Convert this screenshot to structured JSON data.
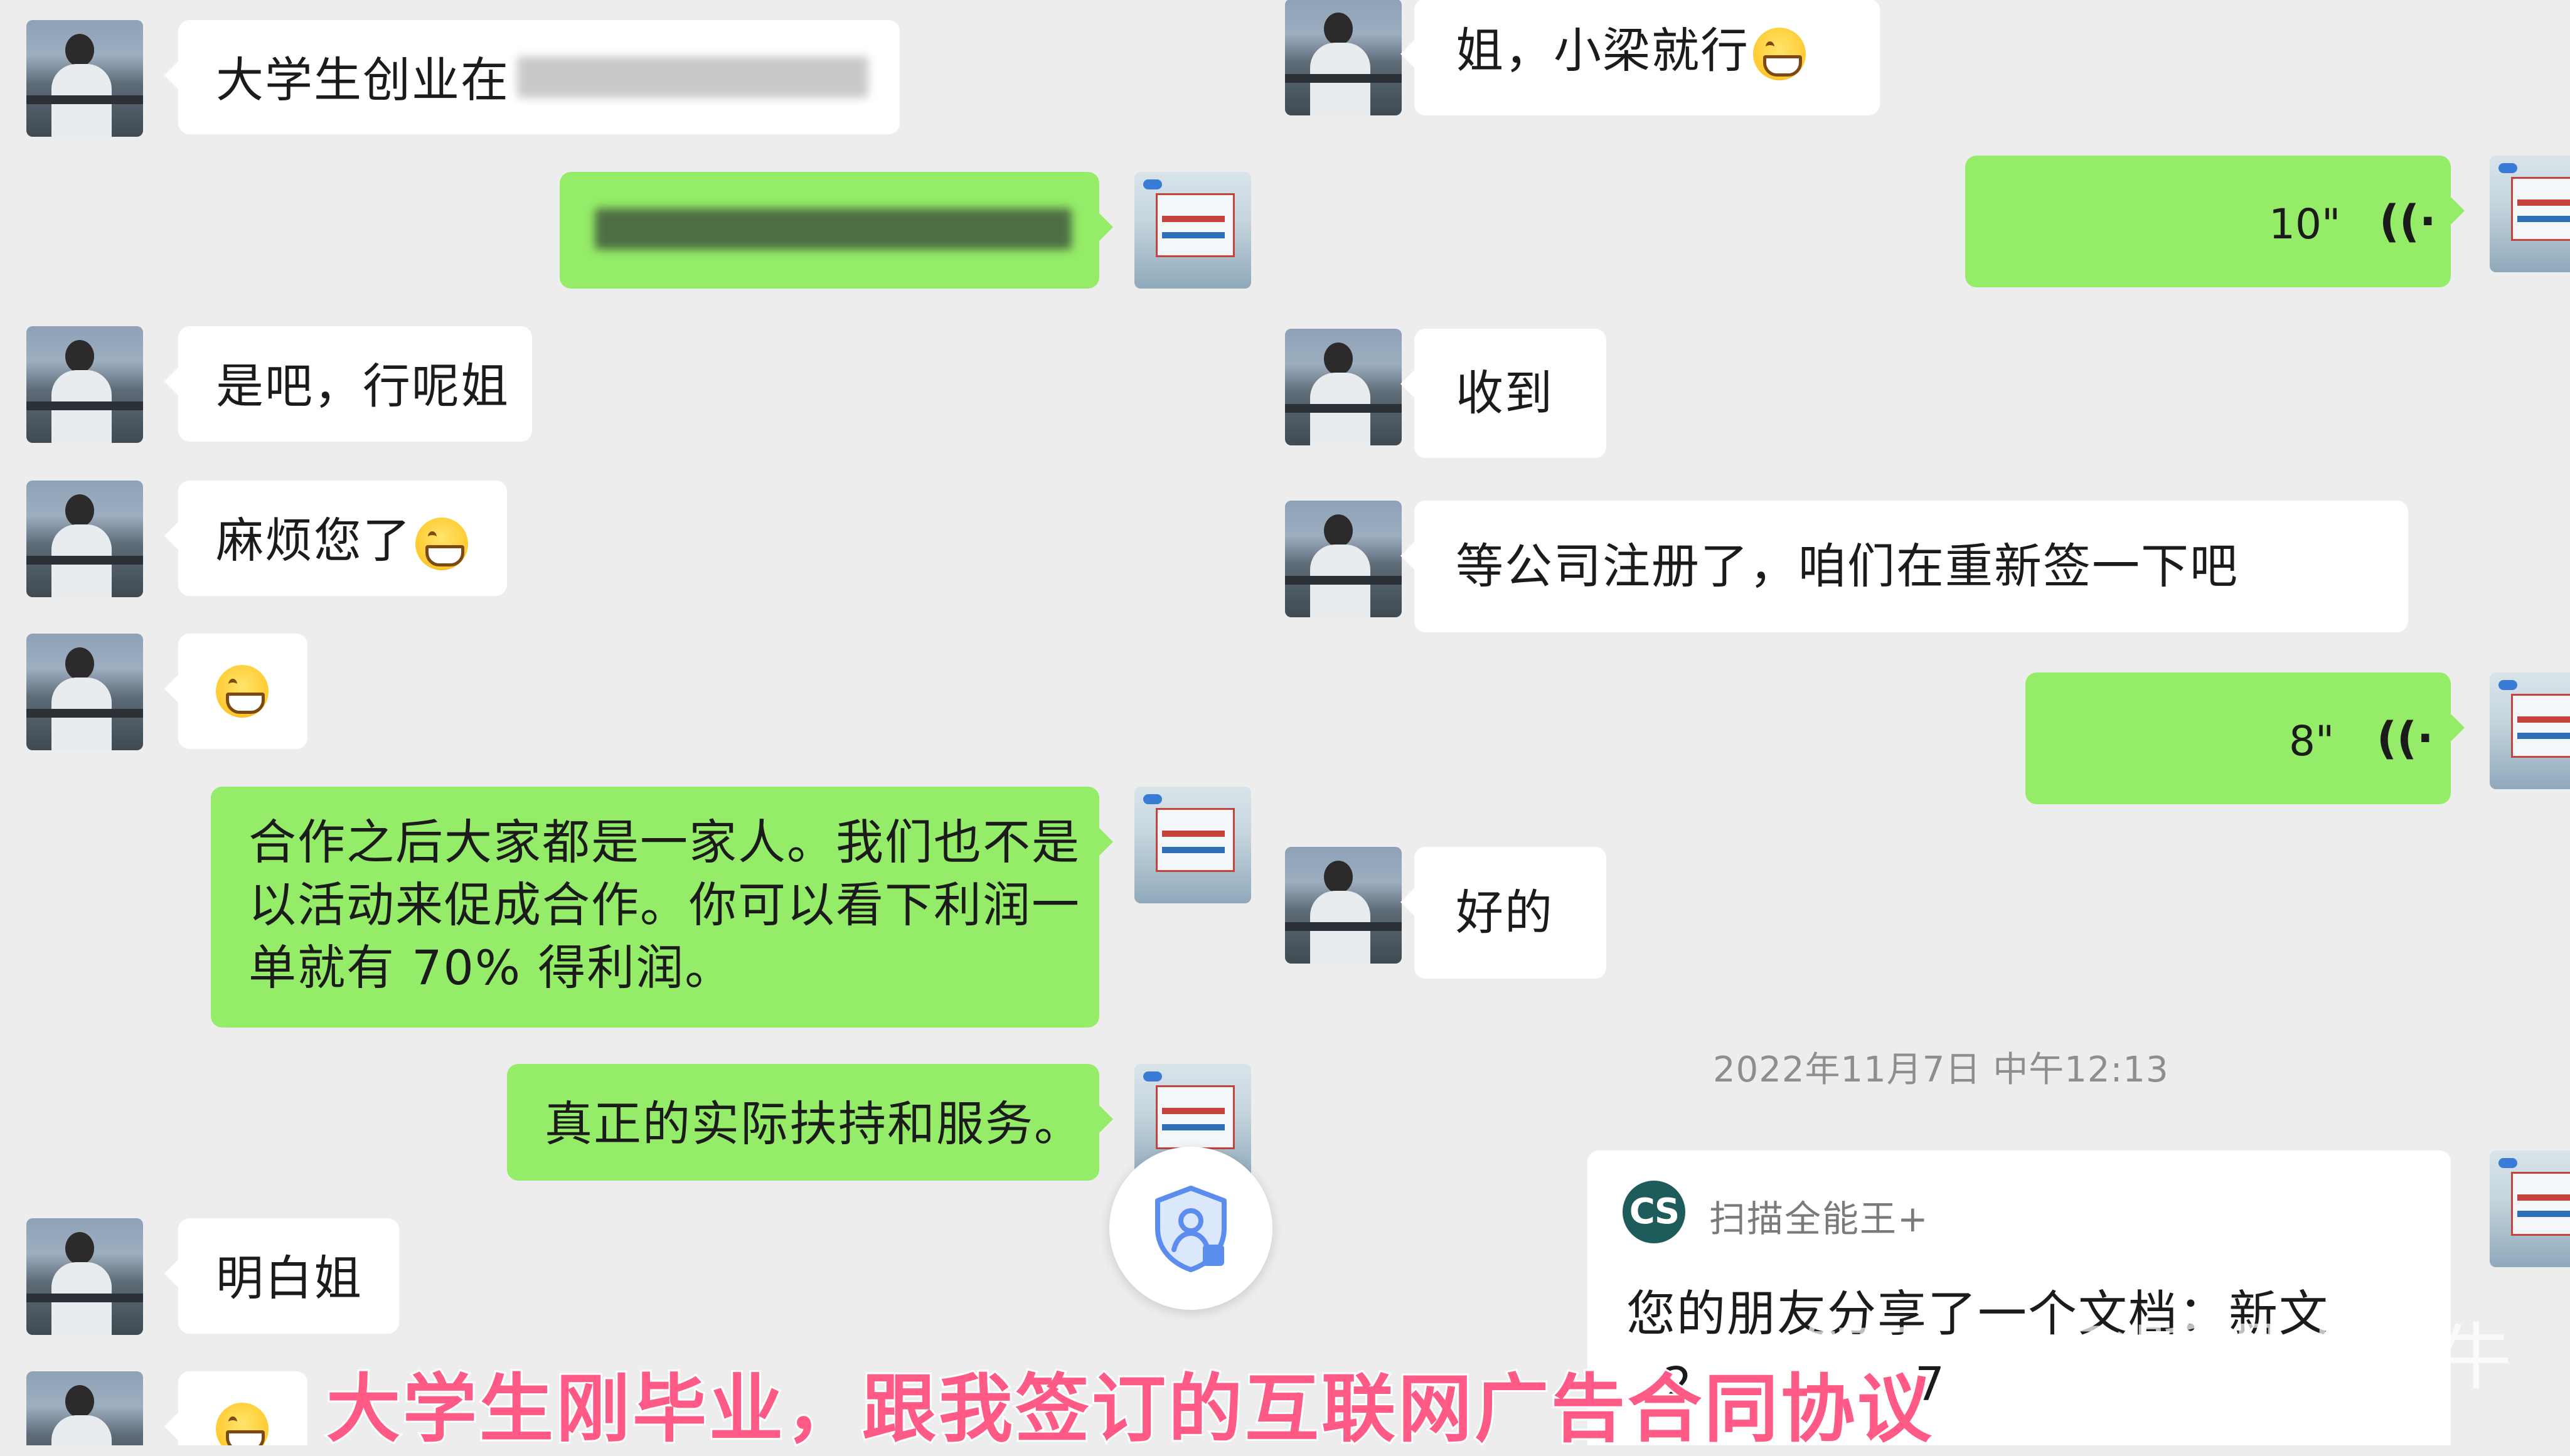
{
  "left_chat": {
    "messages": [
      {
        "text": "大学生创业在"
      },
      {
        "text": ""
      },
      {
        "text": "是吧，行呢姐"
      },
      {
        "text": "麻烦您了"
      },
      {
        "text": ""
      },
      {
        "lines": [
          "合作之后大家都是一家人。我们也不是",
          "以活动来促成合作。你可以看下利润一",
          "单就有 70% 得利润。"
        ]
      },
      {
        "text": "真正的实际扶持和服务。"
      },
      {
        "text": "明白姐"
      },
      {
        "text": ""
      }
    ]
  },
  "right_chat": {
    "messages": [
      {
        "text": "姐，小梁就行"
      },
      {
        "duration": "10\""
      },
      {
        "text": "收到"
      },
      {
        "text": "等公司注册了，咱们在重新签一下吧"
      },
      {
        "duration": "8\""
      },
      {
        "text": "好的"
      }
    ],
    "timestamp": "2022年11月7日 中午12:13",
    "file_card": {
      "app_name": "扫描全能王+",
      "logo_text": "CS",
      "message": "您的朋友分享了一个文档：新文",
      "line2": "2",
      "line2_end": "7"
    }
  },
  "floating_button": {
    "icon": "shield-user-icon"
  },
  "caption": "大学生刚毕业，跟我签订的互联网广告合同协议",
  "watermark": "知乎 @飞跃得小蜗牛",
  "colors": {
    "background": "#ededed",
    "outgoing_bubble": "#95ec69",
    "incoming_bubble": "#ffffff",
    "caption": "#ff5a85"
  }
}
